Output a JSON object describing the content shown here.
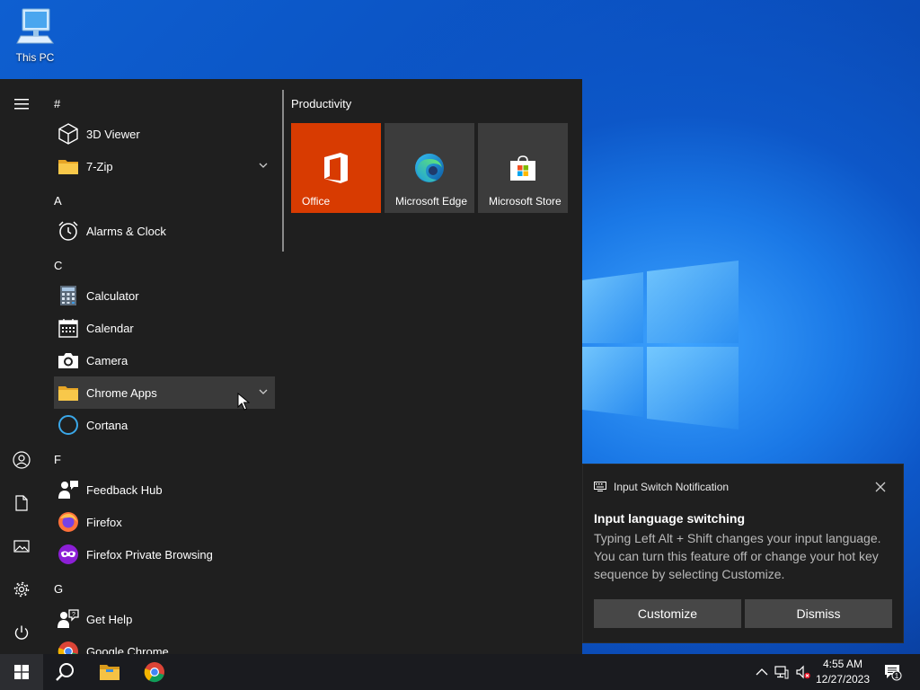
{
  "desktop": {
    "icon_label": "This PC"
  },
  "start_menu": {
    "sections": [
      {
        "header": "#",
        "items": [
          {
            "label": "3D Viewer",
            "icon": "cube-icon",
            "expandable": false
          },
          {
            "label": "7-Zip",
            "icon": "folder-icon",
            "expandable": true
          }
        ]
      },
      {
        "header": "A",
        "items": [
          {
            "label": "Alarms & Clock",
            "icon": "alarm-clock-icon",
            "expandable": false
          }
        ]
      },
      {
        "header": "C",
        "items": [
          {
            "label": "Calculator",
            "icon": "calculator-icon",
            "expandable": false
          },
          {
            "label": "Calendar",
            "icon": "calendar-icon",
            "expandable": false
          },
          {
            "label": "Camera",
            "icon": "camera-icon",
            "expandable": false
          },
          {
            "label": "Chrome Apps",
            "icon": "folder-icon",
            "expandable": true,
            "hovered": true
          },
          {
            "label": "Cortana",
            "icon": "cortana-icon",
            "expandable": false
          }
        ]
      },
      {
        "header": "F",
        "items": [
          {
            "label": "Feedback Hub",
            "icon": "feedback-icon",
            "expandable": false
          },
          {
            "label": "Firefox",
            "icon": "firefox-icon",
            "expandable": false
          },
          {
            "label": "Firefox Private Browsing",
            "icon": "firefox-private-icon",
            "expandable": false
          }
        ]
      },
      {
        "header": "G",
        "items": [
          {
            "label": "Get Help",
            "icon": "help-icon",
            "expandable": false
          },
          {
            "label": "Google Chrome",
            "icon": "chrome-icon",
            "expandable": false
          }
        ]
      }
    ],
    "tile_group": "Productivity",
    "tiles": [
      {
        "label": "Office",
        "icon": "office-icon",
        "color": "#d83b01"
      },
      {
        "label": "Microsoft Edge",
        "icon": "edge-icon",
        "color": "#3c3c3c"
      },
      {
        "label": "Microsoft Store",
        "icon": "store-icon",
        "color": "#3c3c3c"
      }
    ]
  },
  "notification": {
    "app_name": "Input Switch Notification",
    "title": "Input language switching",
    "body": "Typing Left Alt + Shift changes your input language. You can turn this feature off or change your hot key sequence by selecting Customize.",
    "customize_label": "Customize",
    "dismiss_label": "Dismiss"
  },
  "taskbar": {
    "time": "4:55 AM",
    "date": "12/27/2023",
    "notification_count": "1"
  },
  "colors": {
    "office_tile": "#d83b01",
    "menu_bg": "#1f1f1f",
    "taskbar_bg": "#1a1b1f"
  }
}
